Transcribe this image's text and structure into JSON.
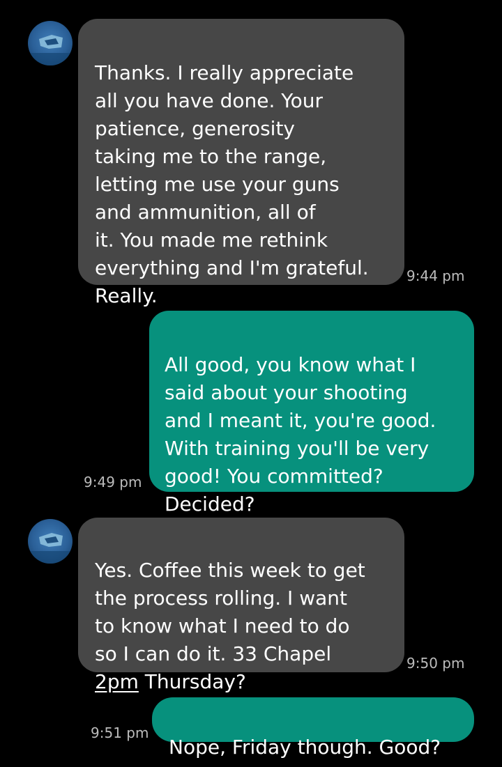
{
  "messages": [
    {
      "direction": "incoming",
      "text": "Thanks. I really appreciate\nall you have done. Your\npatience, generosity\ntaking me to the range,\nletting me use your guns\nand ammunition, all of\nit. You made me rethink\neverything and I'm grateful.\nReally.",
      "time": "9:44 pm"
    },
    {
      "direction": "outgoing",
      "text": "All good, you know what I\nsaid about your shooting\nand I meant it, you're good.\nWith training you'll be very\ngood! You committed?\nDecided?",
      "time": "9:49 pm"
    },
    {
      "direction": "incoming",
      "text_before_link": "Yes. Coffee this week to get\nthe process rolling. I want\nto know what I need to do\nso I can do it. 33 Chapel\n",
      "link": "2pm",
      "text_after_link": " Thursday?",
      "time": "9:50 pm"
    },
    {
      "direction": "outgoing",
      "text": "Nope, Friday though. Good?",
      "time": "9:51 pm"
    }
  ],
  "colors": {
    "background": "#000000",
    "incoming_bubble": "#474747",
    "outgoing_bubble": "#07917d",
    "timestamp": "#bcbcbc"
  },
  "icons": {
    "contact_avatar": "contact-avatar-icon"
  }
}
